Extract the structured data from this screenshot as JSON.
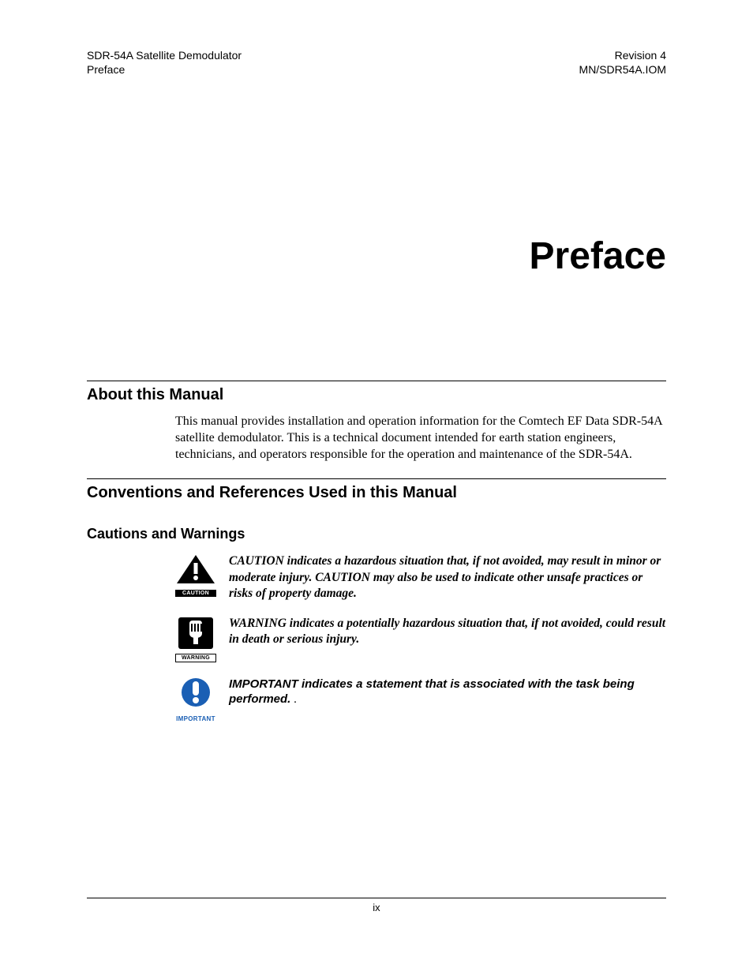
{
  "header": {
    "left_line1": "SDR-54A Satellite Demodulator",
    "left_line2": "Preface",
    "right_line1": "Revision 4",
    "right_line2": "MN/SDR54A.IOM"
  },
  "title": "Preface",
  "sections": {
    "about": {
      "heading": "About this Manual",
      "body": "This manual provides installation and operation information for the Comtech EF Data SDR-54A satellite demodulator. This is a technical document intended for earth station engineers, technicians, and operators responsible for the operation and maintenance of the SDR-54A."
    },
    "conventions": {
      "heading": "Conventions and References Used in this Manual"
    },
    "cautions": {
      "heading": "Cautions and Warnings",
      "items": {
        "caution": {
          "label": "CAUTION",
          "text": "CAUTION indicates a hazardous situation that, if not avoided, may result in minor or moderate injury. CAUTION may also be used to indicate other unsafe practices or risks of property damage."
        },
        "warning": {
          "label": "WARNING",
          "text": "WARNING indicates a potentially hazardous situation that, if not avoided, could result in death or serious injury."
        },
        "important": {
          "label": "IMPORTANT",
          "text": "IMPORTANT indicates a statement that is associated with the task being performed.",
          "trailing": " ."
        }
      }
    }
  },
  "footer": {
    "page_number": "ix"
  }
}
